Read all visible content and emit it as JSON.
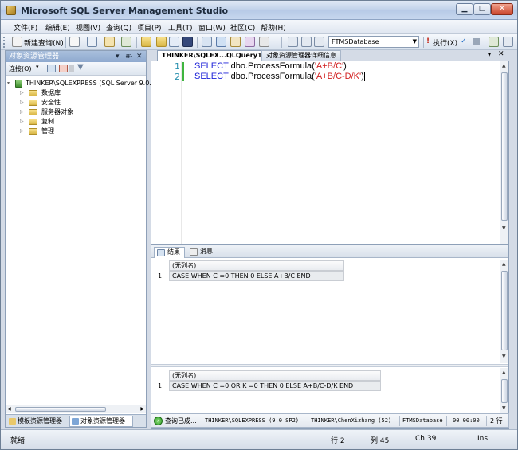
{
  "window": {
    "title": "Microsoft SQL Server Management Studio"
  },
  "menu": [
    "文件(F)",
    "编辑(E)",
    "视图(V)",
    "查询(Q)",
    "项目(P)",
    "工具(T)",
    "窗口(W)",
    "社区(C)",
    "帮助(H)"
  ],
  "toolbar": {
    "new_query": "新建查询(N)",
    "database": "FTMSDatabase",
    "execute": "执行(X)"
  },
  "object_explorer": {
    "title": "对象资源管理器",
    "connect": "连接(O)",
    "server": "THINKER\\SQLEXPRESS (SQL Server 9.0.3",
    "nodes": [
      "数据库",
      "安全性",
      "服务器对象",
      "复制",
      "管理"
    ],
    "bottom_tabs": [
      "模板资源管理器",
      "对象资源管理器"
    ]
  },
  "editor": {
    "tabs": [
      "THINKER\\SQLEX...QLQuery1.sql*",
      "对象资源管理器详细信息"
    ],
    "lines": [
      {
        "num": "1",
        "kw": "SELECT",
        "mid": " dbo.ProcessFormula(",
        "str": "'A+B/C'",
        "end": ")"
      },
      {
        "num": "2",
        "kw": "SELECT",
        "mid": " dbo.ProcessFormula(",
        "str": "'A+B/C-D/K'",
        "end": ")"
      }
    ]
  },
  "results": {
    "tabs": [
      "结果",
      "消息"
    ],
    "grid1": {
      "header": "(无列名)",
      "row_num": "1",
      "value": "CASE WHEN C =0   THEN 0 ELSE A+B/C END"
    },
    "grid2": {
      "header": "(无列名)",
      "row_num": "1",
      "value": "CASE WHEN C =0  OR K =0   THEN 0 ELSE A+B/C-D/K END"
    }
  },
  "query_status": {
    "message": "查询已成...",
    "server": "THINKER\\SQLEXPRESS (9.0 SP2)",
    "user": "THINKER\\ChenXizhang (52)",
    "database": "FTMSDatabase",
    "time": "00:00:00",
    "rows": "2 行"
  },
  "status_bar": {
    "state": "就绪",
    "line": "行 2",
    "col": "列 45",
    "ch": "Ch 39",
    "mode": "Ins"
  },
  "colors": {
    "keyword": "#1c21d8",
    "string": "#d11e1e",
    "line_number": "#2b91af",
    "modified_bar": "#3fb53f"
  }
}
